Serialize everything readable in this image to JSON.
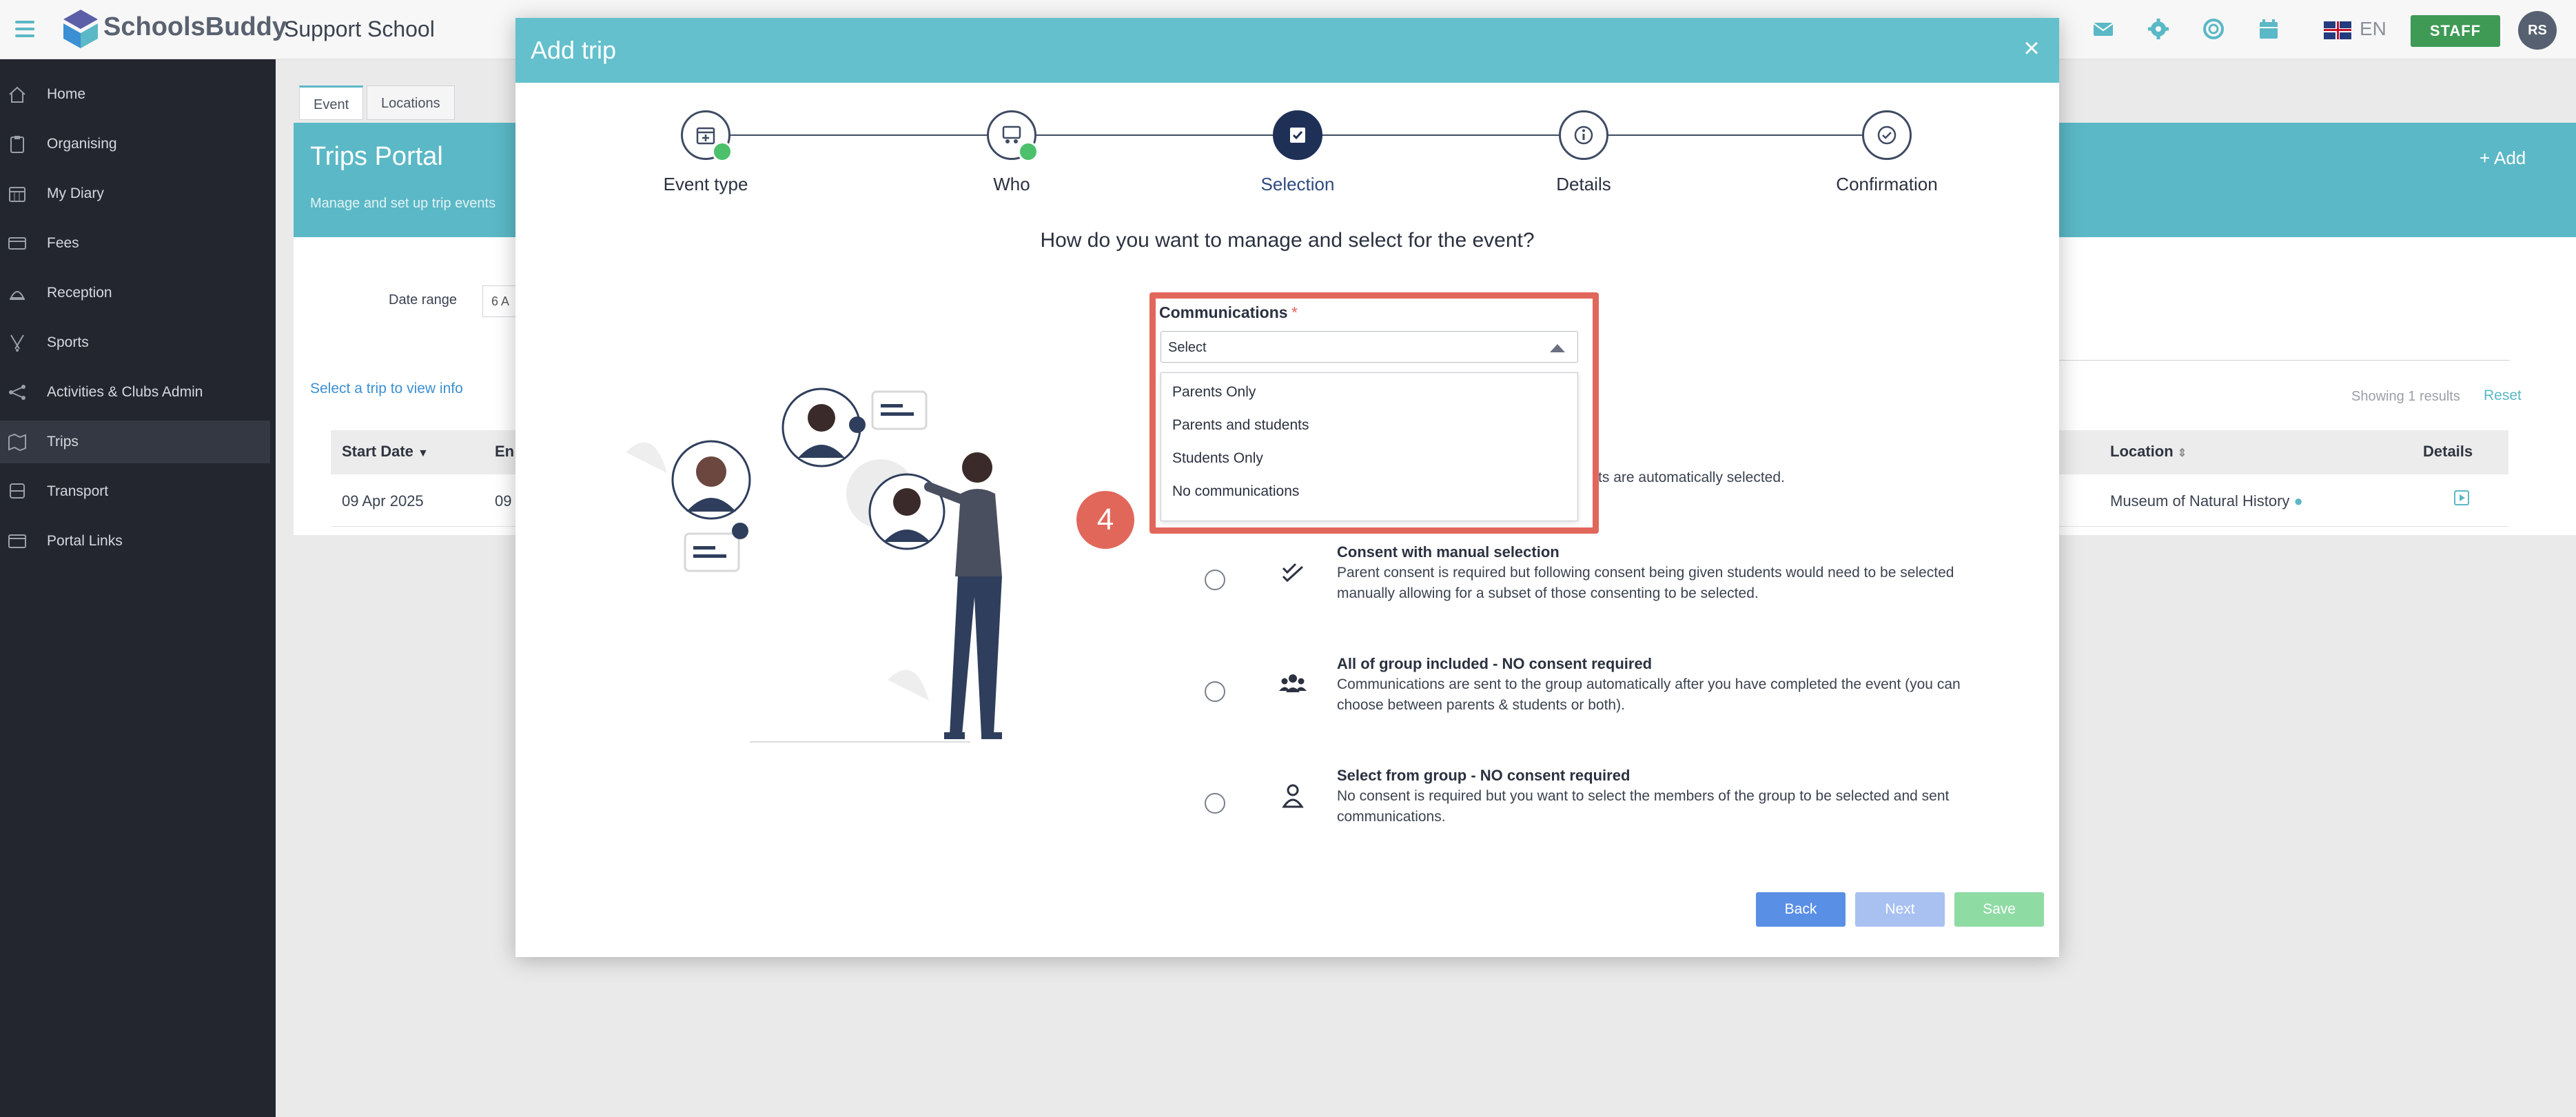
{
  "app": {
    "logo_text": "SchoolsBuddy",
    "school_name": "Support School",
    "language": "EN",
    "staff_label": "STAFF",
    "avatar_initials": "RS"
  },
  "sidebar": {
    "items": [
      {
        "label": "Home",
        "icon": "home-icon"
      },
      {
        "label": "Organising",
        "icon": "clipboard-icon"
      },
      {
        "label": "My Diary",
        "icon": "calendar-icon"
      },
      {
        "label": "Fees",
        "icon": "card-icon"
      },
      {
        "label": "Reception",
        "icon": "bell-icon"
      },
      {
        "label": "Sports",
        "icon": "hockey-icon"
      },
      {
        "label": "Activities & Clubs Admin",
        "icon": "network-icon"
      },
      {
        "label": "Trips",
        "icon": "map-icon",
        "active": true
      },
      {
        "label": "Transport",
        "icon": "bus-icon"
      },
      {
        "label": "Portal Links",
        "icon": "window-icon"
      }
    ]
  },
  "background": {
    "tabs": [
      "Event",
      "Locations"
    ],
    "portal_title": "Trips Portal",
    "portal_subtitle": "Manage and set up trip events",
    "add_label": "+ Add",
    "date_range_label": "Date range",
    "date_field_value": "6 A",
    "select_trip_text": "Select a trip to view info",
    "showing_text": "Showing 1 results",
    "reset_label": "Reset",
    "table": {
      "headers": [
        "Start Date",
        "En",
        "Location",
        "Details"
      ],
      "row": {
        "start_date": "09 Apr 2025",
        "end_date": "09",
        "location": "Museum of Natural History"
      }
    }
  },
  "modal": {
    "title": "Add trip",
    "steps": [
      {
        "label": "Event type",
        "status": "done"
      },
      {
        "label": "Who",
        "status": "done"
      },
      {
        "label": "Selection",
        "status": "current"
      },
      {
        "label": "Details",
        "status": "pending"
      },
      {
        "label": "Confirmation",
        "status": "pending"
      }
    ],
    "question": "How do you want to manage and select for the event?",
    "communications": {
      "label": "Communications",
      "required_mark": "*",
      "selected": "Select",
      "options": [
        "Parents Only",
        "Parents and students",
        "Students Only",
        "No communications"
      ]
    },
    "partial_option_text": "lowing consent being given students are automatically selected.",
    "options": [
      {
        "title": "Consent with manual selection",
        "description": "Parent consent is required but following consent being given students would need to be selected manually allowing for a subset of those consenting to be selected.",
        "icon": "double-check-icon"
      },
      {
        "title": "All of group included - NO consent required",
        "description": "Communications are sent to the group automatically after you have completed the event (you can choose between parents & students or both).",
        "icon": "group-icon"
      },
      {
        "title": "Select from group - NO consent required",
        "description": "No consent is required but you want to select the members of the group to be selected and sent communications.",
        "icon": "person-icon"
      }
    ],
    "annotation_number": "4",
    "buttons": {
      "back": "Back",
      "next": "Next",
      "save": "Save"
    }
  },
  "colors": {
    "header_teal": "#63c0cc",
    "highlight_red": "#e2675b",
    "sidebar_dark": "#23262e",
    "stepper_navy": "#1f3057"
  }
}
